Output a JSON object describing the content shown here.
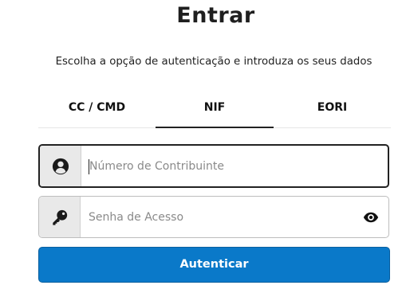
{
  "header": {
    "title": "Entrar",
    "subtitle": "Escolha a opção de autenticação e introduza os seus dados"
  },
  "tabs": [
    {
      "label": "CC / CMD",
      "active": false
    },
    {
      "label": "NIF",
      "active": true
    },
    {
      "label": "EORI",
      "active": false
    }
  ],
  "form": {
    "nif": {
      "placeholder": "Número de Contribuinte",
      "value": "",
      "icon": "user-icon"
    },
    "password": {
      "placeholder": "Senha de Acesso",
      "value": "",
      "icon": "key-icon",
      "toggle_icon": "eye-icon"
    },
    "submit_label": "Autenticar"
  },
  "colors": {
    "accent": "#0a79c9",
    "addon_bg": "#e9e9e9",
    "text": "#222222"
  }
}
